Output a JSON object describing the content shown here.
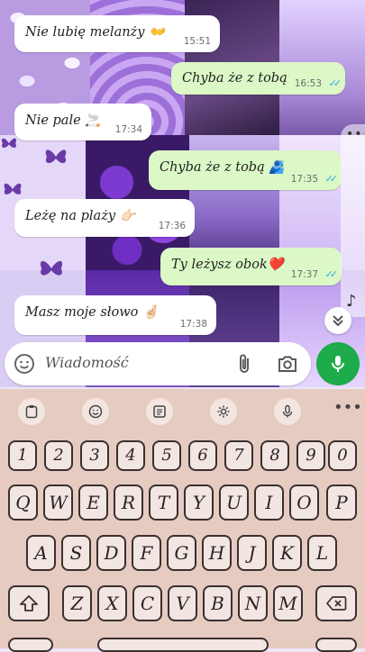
{
  "chat": {
    "messages": [
      {
        "dir": "in",
        "text": "Nie lubię melanży 👐",
        "time": "15:51"
      },
      {
        "dir": "out",
        "text": "Chyba że z tobą",
        "time": "16:53"
      },
      {
        "dir": "in",
        "text": "Nie pale 🚬",
        "time": "17:34"
      },
      {
        "dir": "out",
        "text": "Chyba że z tobą 🫂",
        "time": "17:35"
      },
      {
        "dir": "in",
        "text": "Leżę na plaży 👉🏻",
        "time": "17:36"
      },
      {
        "dir": "out",
        "text": "Ty leżysz obok❤️",
        "time": "17:37"
      },
      {
        "dir": "in",
        "text": "Masz moje słowo 🤞🏻",
        "time": "17:38"
      }
    ],
    "read_ticks": "✓✓"
  },
  "side": {
    "menu_dots": "•••",
    "note": "♪",
    "scroll_down": "⌄⌄"
  },
  "input": {
    "placeholder": "Wiadomość"
  },
  "icons": {
    "emoji": "emoji-icon",
    "attach": "paperclip-icon",
    "camera": "camera-icon",
    "mic": "microphone-icon",
    "clipboard": "clipboard-icon",
    "emoji_kb": "smiley-icon",
    "sticker": "sticker-icon",
    "settings": "gear-icon",
    "voice": "microphone-icon",
    "more": "more-dots-icon",
    "shift": "shift-icon",
    "backspace": "backspace-icon"
  },
  "keyboard": {
    "more_label": "•••",
    "numbers": [
      "1",
      "2",
      "3",
      "4",
      "5",
      "6",
      "7",
      "8",
      "9",
      "0"
    ],
    "row1": [
      "Q",
      "W",
      "E",
      "R",
      "T",
      "Y",
      "U",
      "I",
      "O",
      "P"
    ],
    "row2": [
      "A",
      "S",
      "D",
      "F",
      "G",
      "H",
      "J",
      "K",
      "L"
    ],
    "row3": [
      "Z",
      "X",
      "C",
      "V",
      "B",
      "N",
      "M"
    ]
  },
  "colors": {
    "accent": "#1dab4b",
    "outgoing_bubble": "#dbf8c6",
    "incoming_bubble": "#ffffff",
    "read_ticks": "#34a4e5",
    "keyboard_bg": "#e6cbc1"
  }
}
